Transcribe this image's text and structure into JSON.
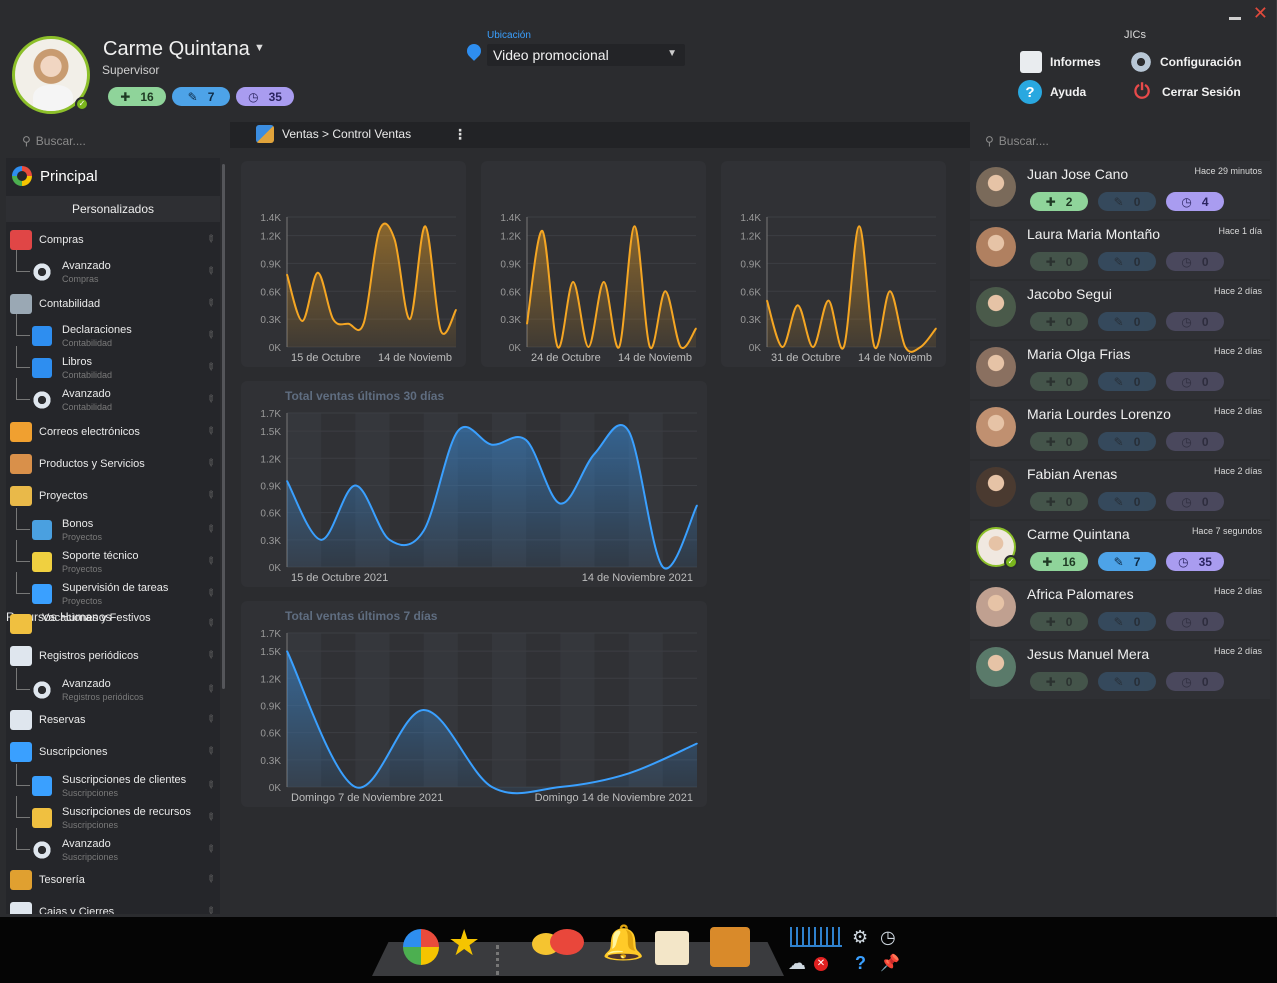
{
  "user": {
    "name": "Carme Quintana",
    "role": "Supervisor",
    "badges": {
      "green": "16",
      "blue": "7",
      "purple": "35"
    }
  },
  "location": {
    "label": "Ubicación",
    "value": "Video promocional"
  },
  "topright": {
    "group": "JICs",
    "informes": "Informes",
    "configuracion": "Configuración",
    "ayuda": "Ayuda",
    "cerrar": "Cerrar Sesión"
  },
  "search": {
    "left_placeholder": "Buscar....",
    "right_placeholder": "Buscar...."
  },
  "breadcrumb": "Ventas > Control Ventas",
  "sidebar": {
    "principal": "Principal",
    "personalizados": "Personalizados",
    "items": [
      {
        "label": "Compras"
      },
      {
        "label": "Avanzado",
        "sub": "Compras"
      },
      {
        "label": "Contabilidad"
      },
      {
        "label": "Declaraciones",
        "sub": "Contabilidad"
      },
      {
        "label": "Libros",
        "sub": "Contabilidad"
      },
      {
        "label": "Avanzado",
        "sub": "Contabilidad"
      },
      {
        "label": "Correos electrónicos"
      },
      {
        "label": "Productos y Servicios"
      },
      {
        "label": "Proyectos"
      },
      {
        "label": "Bonos",
        "sub": "Proyectos"
      },
      {
        "label": "Soporte técnico",
        "sub": "Proyectos"
      },
      {
        "label": "Supervisión de tareas",
        "sub": "Proyectos"
      },
      {
        "label": "Vacaciones y Festivos",
        "sub": "Recursos Humanos"
      },
      {
        "label": "Registros periódicos"
      },
      {
        "label": "Avanzado",
        "sub": "Registros periódicos"
      },
      {
        "label": "Reservas"
      },
      {
        "label": "Suscripciones"
      },
      {
        "label": "Suscripciones de clientes",
        "sub": "Suscripciones"
      },
      {
        "label": "Suscripciones de recursos",
        "sub": "Suscripciones"
      },
      {
        "label": "Avanzado",
        "sub": "Suscripciones"
      },
      {
        "label": "Tesorería"
      },
      {
        "label": "Cajas y Cierres"
      }
    ]
  },
  "chart_data": [
    {
      "type": "area",
      "ylim": [
        0,
        1400
      ],
      "yticks": [
        "0K",
        "0.3K",
        "0.6K",
        "0.9K",
        "1.2K",
        "1.4K"
      ],
      "xticks": [
        "15 de Octubre",
        "14 de Noviemb"
      ],
      "color": "#f5a623",
      "values": [
        780,
        280,
        800,
        300,
        250,
        260,
        1250,
        1160,
        300,
        1300,
        180,
        400
      ]
    },
    {
      "type": "area",
      "ylim": [
        0,
        1400
      ],
      "yticks": [
        "0K",
        "0.3K",
        "0.6K",
        "0.9K",
        "1.2K",
        "1.4K"
      ],
      "xticks": [
        "24 de Octubre",
        "14 de Noviemb"
      ],
      "color": "#f5a623",
      "values": [
        250,
        1250,
        0,
        700,
        0,
        700,
        0,
        1300,
        0,
        600,
        0,
        200
      ]
    },
    {
      "type": "area",
      "ylim": [
        0,
        1400
      ],
      "yticks": [
        "0K",
        "0.3K",
        "0.6K",
        "0.9K",
        "1.2K",
        "1.4K"
      ],
      "xticks": [
        "31 de Octubre",
        "14 de Noviemb"
      ],
      "color": "#f5a623",
      "values": [
        500,
        0,
        450,
        0,
        500,
        0,
        1300,
        0,
        600,
        0,
        0,
        200
      ]
    },
    {
      "type": "area",
      "title": "Total ventas últimos 30 días",
      "ylim": [
        0,
        1700
      ],
      "yticks": [
        "0K",
        "0.3K",
        "0.6K",
        "0.9K",
        "1.2K",
        "1.5K",
        "1.7K"
      ],
      "xticks": [
        "15 de Octubre 2021",
        "14 de Noviembre 2021"
      ],
      "color": "#3aa0ff",
      "values": [
        950,
        300,
        900,
        300,
        400,
        1500,
        1350,
        1400,
        700,
        1250,
        1500,
        0,
        680
      ]
    },
    {
      "type": "area",
      "title": "Total ventas últimos 7 días",
      "ylim": [
        0,
        1700
      ],
      "yticks": [
        "0K",
        "0.3K",
        "0.6K",
        "0.9K",
        "1.2K",
        "1.5K",
        "1.7K"
      ],
      "xticks": [
        "Domingo 7 de Noviembre 2021",
        "Domingo 14 de Noviembre 2021"
      ],
      "color": "#3aa0ff",
      "values": [
        1500,
        0,
        850,
        0,
        0,
        150,
        480
      ]
    }
  ],
  "contacts": [
    {
      "name": "Juan Jose Cano",
      "time": "Hace 29 minutos",
      "g": "2",
      "b": "0",
      "p": "4",
      "active": true
    },
    {
      "name": "Laura Maria Montaño",
      "time": "Hace 1 día",
      "g": "0",
      "b": "0",
      "p": "0",
      "active": false
    },
    {
      "name": "Jacobo Segui",
      "time": "Hace 2 días",
      "g": "0",
      "b": "0",
      "p": "0",
      "active": false
    },
    {
      "name": "Maria Olga Frias",
      "time": "Hace 2 días",
      "g": "0",
      "b": "0",
      "p": "0",
      "active": false
    },
    {
      "name": "Maria Lourdes Lorenzo",
      "time": "Hace 2 días",
      "g": "0",
      "b": "0",
      "p": "0",
      "active": false
    },
    {
      "name": "Fabian Arenas",
      "time": "Hace 2 días",
      "g": "0",
      "b": "0",
      "p": "0",
      "active": false
    },
    {
      "name": "Carme Quintana",
      "time": "Hace 7 segundos",
      "g": "16",
      "b": "7",
      "p": "35",
      "active": true
    },
    {
      "name": "Africa Palomares",
      "time": "Hace 2 días",
      "g": "0",
      "b": "0",
      "p": "0",
      "active": false
    },
    {
      "name": "Jesus Manuel Mera",
      "time": "Hace 2 días",
      "g": "0",
      "b": "0",
      "p": "0",
      "active": false
    }
  ]
}
